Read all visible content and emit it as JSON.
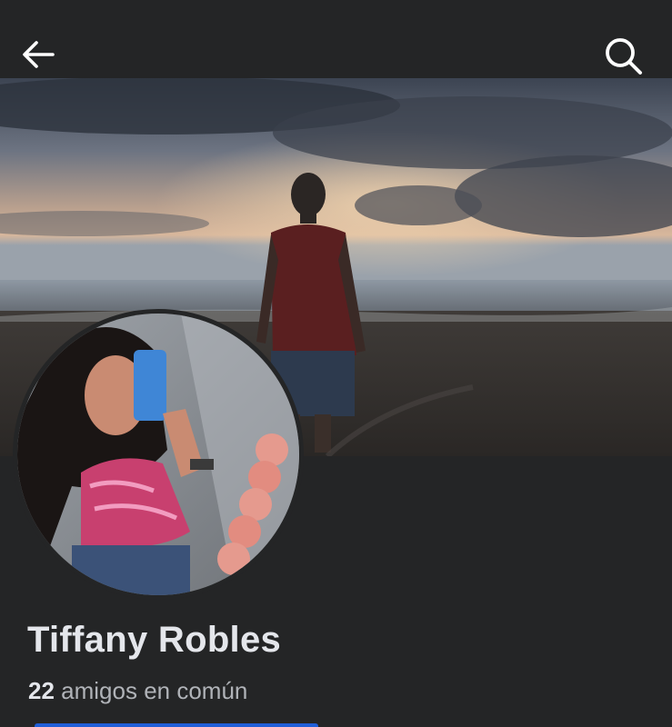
{
  "header": {
    "back_icon": "arrow-left-icon",
    "search_icon": "search-icon"
  },
  "profile": {
    "name": "Tiffany Robles",
    "mutual_count": "22",
    "mutual_label": "amigos en común"
  },
  "colors": {
    "background": "#242526",
    "text_primary": "#e4e6eb",
    "text_secondary": "#b0b3b8",
    "accent": "#1f5ed8"
  }
}
